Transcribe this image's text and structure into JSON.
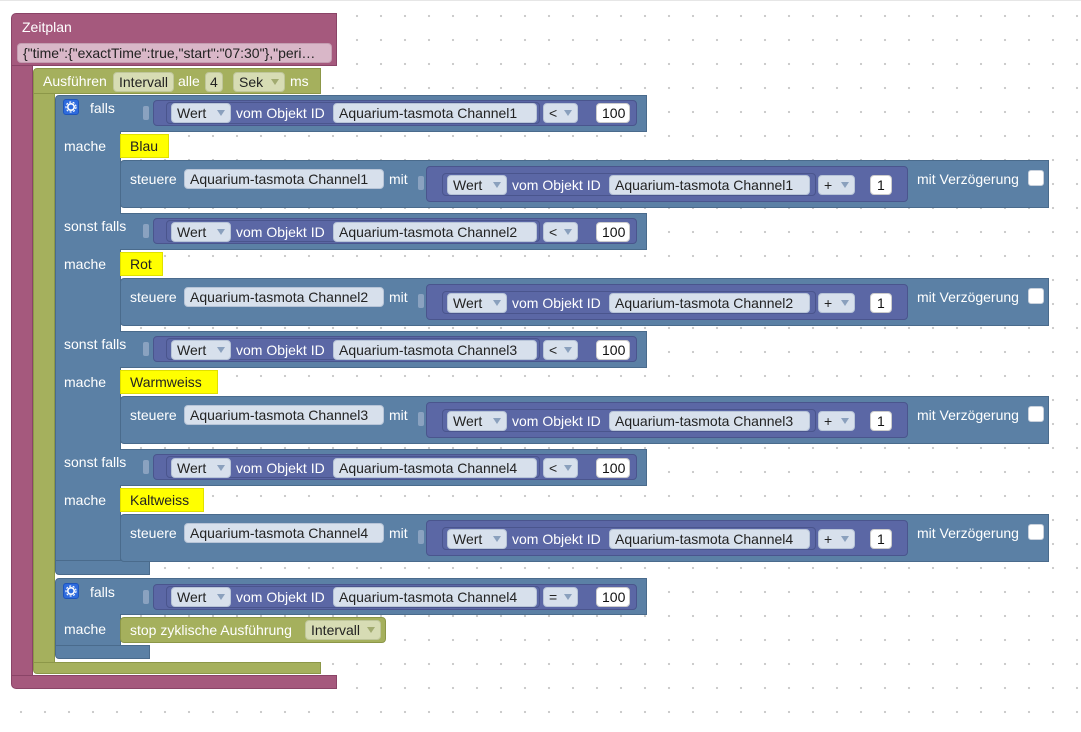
{
  "workspace": {
    "zeitplan": {
      "title": "Zeitplan",
      "schedule_value": "{\"time\":{\"exactTime\":true,\"start\":\"07:30\"},\"peri…"
    },
    "interval": {
      "label_run": "Ausführen",
      "label_interval": "Intervall",
      "label_every": "alle",
      "value": "4",
      "unit_dropdown": "Sek",
      "unit_ms": "ms"
    },
    "if_block_1": {
      "branches": [
        {
          "keyword": "falls",
          "do_label": "mache",
          "compare": {
            "mode": "Wert",
            "of_object": "vom Objekt ID",
            "object_id": "Aquarium-tasmota  Channel1",
            "operator": "<",
            "value": "100"
          },
          "comment": "Blau",
          "control": {
            "label": "steuere",
            "object_id": "Aquarium-tasmota  Channel1",
            "with_label": "mit",
            "mode": "Wert",
            "of_object": "vom Objekt ID",
            "source_id": "Aquarium-tasmota  Channel1",
            "operator": "+",
            "value": "1",
            "delay_label": "mit Verzögerung",
            "delay_checked": false
          }
        },
        {
          "keyword": "sonst falls",
          "do_label": "mache",
          "compare": {
            "mode": "Wert",
            "of_object": "vom Objekt ID",
            "object_id": "Aquarium-tasmota  Channel2",
            "operator": "<",
            "value": "100"
          },
          "comment": "Rot",
          "control": {
            "label": "steuere",
            "object_id": "Aquarium-tasmota  Channel2",
            "with_label": "mit",
            "mode": "Wert",
            "of_object": "vom Objekt ID",
            "source_id": "Aquarium-tasmota  Channel2",
            "operator": "+",
            "value": "1",
            "delay_label": "mit Verzögerung",
            "delay_checked": false
          }
        },
        {
          "keyword": "sonst falls",
          "do_label": "mache",
          "compare": {
            "mode": "Wert",
            "of_object": "vom Objekt ID",
            "object_id": "Aquarium-tasmota  Channel3",
            "operator": "<",
            "value": "100"
          },
          "comment": "Warmweiss",
          "control": {
            "label": "steuere",
            "object_id": "Aquarium-tasmota  Channel3",
            "with_label": "mit",
            "mode": "Wert",
            "of_object": "vom Objekt ID",
            "source_id": "Aquarium-tasmota  Channel3",
            "operator": "+",
            "value": "1",
            "delay_label": "mit Verzögerung",
            "delay_checked": false
          }
        },
        {
          "keyword": "sonst falls",
          "do_label": "mache",
          "compare": {
            "mode": "Wert",
            "of_object": "vom Objekt ID",
            "object_id": "Aquarium-tasmota  Channel4",
            "operator": "<",
            "value": "100"
          },
          "comment": "Kaltweiss",
          "control": {
            "label": "steuere",
            "object_id": "Aquarium-tasmota  Channel4",
            "with_label": "mit",
            "mode": "Wert",
            "of_object": "vom Objekt ID",
            "source_id": "Aquarium-tasmota  Channel4",
            "operator": "+",
            "value": "1",
            "delay_label": "mit Verzögerung",
            "delay_checked": false
          }
        }
      ]
    },
    "if_block_2": {
      "keyword": "falls",
      "do_label": "mache",
      "compare": {
        "mode": "Wert",
        "of_object": "vom Objekt ID",
        "object_id": "Aquarium-tasmota  Channel4",
        "operator": "=",
        "value": "100"
      },
      "stop": {
        "label": "stop zyklische Ausführung",
        "target": "Intervall"
      }
    },
    "colors": {
      "schedule_block": "#a5597d",
      "interval_block": "#a5b05d",
      "logic_block": "#5b80a5",
      "value_block": "#5b67a5",
      "comment_bg": "#ffff00",
      "gear_button": "#2e6bde"
    },
    "icons": [
      "gear-icon",
      "dropdown-arrow-icon",
      "checkbox-icon"
    ]
  }
}
